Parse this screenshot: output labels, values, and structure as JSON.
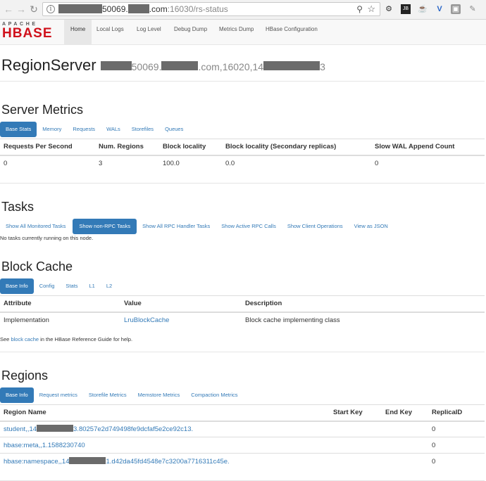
{
  "browser": {
    "url_host_visible_1": "50069.",
    "url_host_visible_2": ".com",
    "url_port_path": ":16030/rs-status"
  },
  "logo": {
    "top": "APACHE",
    "main": "HBASE"
  },
  "nav": [
    "Home",
    "Local Logs",
    "Log Level",
    "Debug Dump",
    "Metrics Dump",
    "HBase Configuration"
  ],
  "page_title": {
    "main": "RegionServer",
    "host_part1": "50069.",
    "host_part2": ".com,16020,14",
    "host_part3": "3"
  },
  "server_metrics": {
    "heading": "Server Metrics",
    "tabs": [
      "Base Stats",
      "Memory",
      "Requests",
      "WALs",
      "Storefiles",
      "Queues"
    ],
    "columns": [
      "Requests Per Second",
      "Num. Regions",
      "Block locality",
      "Block locality (Secondary replicas)",
      "Slow WAL Append Count"
    ],
    "row": [
      "0",
      "3",
      "100.0",
      "0.0",
      "0"
    ]
  },
  "tasks": {
    "heading": "Tasks",
    "tabs": [
      "Show All Monitored Tasks",
      "Show non-RPC Tasks",
      "Show All RPC Handler Tasks",
      "Show Active RPC Calls",
      "Show Client Operations",
      "View as JSON"
    ],
    "message": "No tasks currently running on this node."
  },
  "block_cache": {
    "heading": "Block Cache",
    "tabs": [
      "Base Info",
      "Config",
      "Stats",
      "L1",
      "L2"
    ],
    "columns": [
      "Attribute",
      "Value",
      "Description"
    ],
    "row": [
      "Implementation",
      "LruBlockCache",
      "Block cache implementing class"
    ],
    "note_before": "See ",
    "note_link": "block cache",
    "note_after": " in the HBase Reference Guide for help."
  },
  "regions": {
    "heading": "Regions",
    "tabs": [
      "Base Info",
      "Request metrics",
      "Storefile Metrics",
      "Memstore Metrics",
      "Compaction Metrics"
    ],
    "columns": [
      "Region Name",
      "Start Key",
      "End Key",
      "ReplicaID"
    ],
    "rows": [
      {
        "name_a": "student,,14",
        "name_b": "3.80257e2d749498fe9dcfaf5e2ce92c13.",
        "replica": "0"
      },
      {
        "name_a": "hbase:meta,,1.1588230740",
        "name_b": "",
        "replica": "0"
      },
      {
        "name_a": "hbase:namespace,,14",
        "name_b": "1.d42da45fd4548e7c3200a7716311c45e.",
        "replica": "0"
      }
    ]
  },
  "colors": {
    "accent": "#337ab7",
    "brand": "#d0111b"
  }
}
